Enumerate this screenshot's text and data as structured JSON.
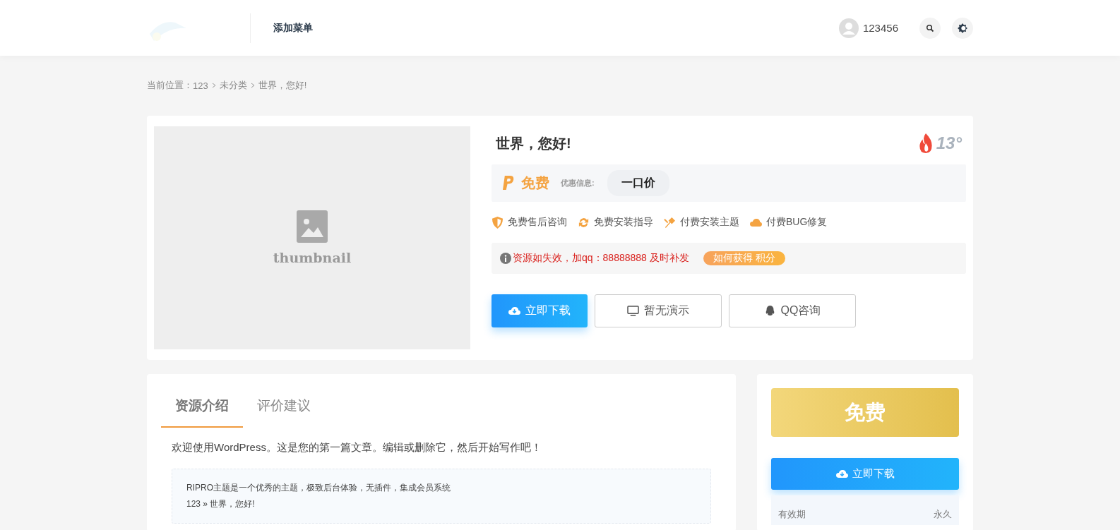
{
  "header": {
    "menu_item": "添加菜单",
    "username": "123456"
  },
  "breadcrumb": {
    "label": "当前位置：",
    "items": [
      "123",
      "未分类",
      "世界，您好!"
    ]
  },
  "product": {
    "thumbnail_text": "thumbnail",
    "title": "世界，您好!",
    "views": "13°",
    "price": "免费",
    "discount_label": "优惠信息:",
    "discount_value": "一口价",
    "features": [
      {
        "kind": "shield",
        "label": "免费售后咨询"
      },
      {
        "kind": "sync",
        "label": "免费安装指导"
      },
      {
        "kind": "tool",
        "label": "付费安装主题"
      },
      {
        "kind": "cloud",
        "label": "付费BUG修复"
      }
    ],
    "notice": "资源如失效，加qq：88888888 及时补发",
    "notice_badge": "如何获得 积分",
    "buttons": [
      {
        "kind": "download",
        "label": "立即下载"
      },
      {
        "kind": "demo",
        "label": "暂无演示"
      },
      {
        "kind": "qq",
        "label": "QQ咨询"
      }
    ]
  },
  "tabs": [
    {
      "label": "资源介绍",
      "selected": true
    },
    {
      "label": "评价建议",
      "selected": false
    }
  ],
  "article": {
    "intro": "欢迎使用WordPress。这是您的第一篇文章。编辑或删除它，然后开始写作吧！",
    "box_lines": [
      "RIPRO主题是一个优秀的主题，极致后台体验，无插件，集成会员系统",
      "123 » 世界，您好!"
    ]
  },
  "sidebar": {
    "price": "免费",
    "download": "立即下载",
    "info": [
      {
        "label": "有效期",
        "value": "永久"
      }
    ]
  }
}
